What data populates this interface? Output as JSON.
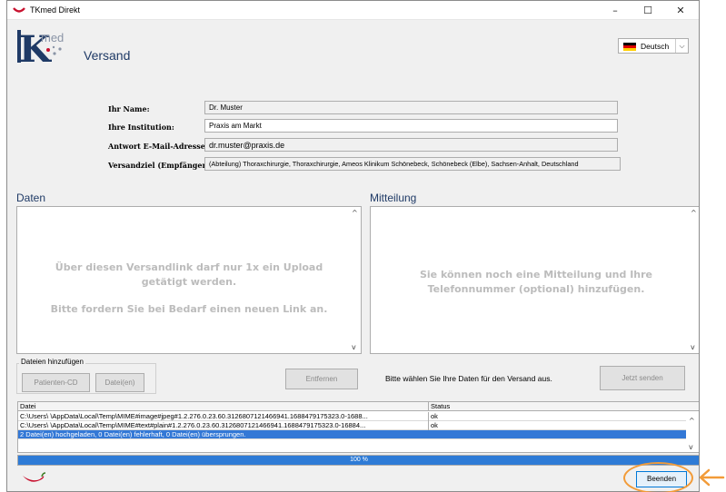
{
  "window": {
    "title": "TKmed Direkt",
    "minimize": "–",
    "maximize": "☐",
    "close": "✕"
  },
  "header": {
    "logo_text": "med",
    "title": "Versand"
  },
  "language": {
    "selected": "Deutsch",
    "flag_colors": [
      "#000000",
      "#dd0000",
      "#ffce00"
    ]
  },
  "form": {
    "name_label": "Ihr Name:",
    "name_value": "Dr. Muster",
    "institution_label": "Ihre Institution:",
    "institution_value": "Praxis am Markt",
    "email_label": "Antwort E-Mail-Adresse:",
    "email_value": "dr.muster@praxis.de",
    "target_label": "Versandziel (Empfänger):",
    "target_value": "(Abteilung) Thoraxchirurgie, Thoraxchirurgie, Ameos Klinikum Schönebeck, Schönebeck (Elbe), Sachsen-Anhalt, Deutschland"
  },
  "data_section": {
    "title": "Daten",
    "message_line1": "Über diesen Versandlink darf nur 1x ein Upload",
    "message_line2": "getätigt werden.",
    "message_line3": "Bitte fordern Sie bei Bedarf einen neuen Link an."
  },
  "message_section": {
    "title": "Mitteilung",
    "message_line1": "Sie können noch eine Mitteilung und Ihre",
    "message_line2": "Telefonnummer (optional) hinzufügen."
  },
  "add_files": {
    "legend": "Dateien hinzufügen",
    "patient_cd_label": "Patienten-CD",
    "files_label": "Datei(en)"
  },
  "remove_label": "Entfernen",
  "hint": "Bitte wählen Sie Ihre Daten für den Versand aus.",
  "send_label": "Jetzt senden",
  "table": {
    "columns": [
      "Datei",
      "Status"
    ],
    "rows": [
      {
        "file": "C:\\Users\\          \\AppData\\Local\\Temp\\MIME#image#jpeg#1.2.276.0.23.60.3126807121466941.1688479175323.0-1688...",
        "status": "ok"
      },
      {
        "file": "C:\\Users\\          \\AppData\\Local\\Temp\\MIME#text#plain#1.2.276.0.23.60.3126807121466941.1688479175323.0-16884...",
        "status": "ok"
      }
    ],
    "summary": "2 Datei(en) hochgeladen, 0 Datei(en) fehlerhaft, 0 Datei(en) übersprungen."
  },
  "progress": {
    "value": 100,
    "label": "100 %"
  },
  "quit_label": "Beenden",
  "colors": {
    "accent": "#2e7bd6",
    "highlight": "#f29b38",
    "brand": "#1f3a66",
    "logo_red": "#c8102e"
  }
}
